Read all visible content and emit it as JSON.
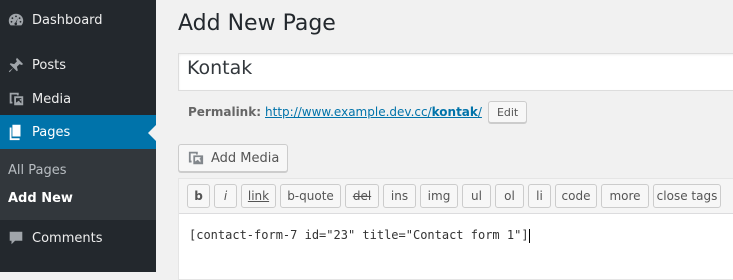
{
  "sidebar": {
    "items": [
      {
        "label": "Dashboard",
        "icon": "dashboard-icon"
      },
      {
        "label": "Posts",
        "icon": "pushpin-icon"
      },
      {
        "label": "Media",
        "icon": "media-icon"
      },
      {
        "label": "Pages",
        "icon": "pages-icon",
        "active": true
      },
      {
        "label": "Comments",
        "icon": "comment-icon"
      }
    ],
    "submenu": [
      {
        "label": "All Pages"
      },
      {
        "label": "Add New",
        "current": true
      }
    ]
  },
  "main": {
    "page_title": "Add New Page",
    "title_value": "Kontak",
    "permalink": {
      "label": "Permalink:",
      "base_url": "http://www.example.dev.cc/",
      "slug": "kontak",
      "trailing": "/",
      "edit_label": "Edit"
    },
    "add_media_label": "Add Media",
    "toolbar": [
      "b",
      "i",
      "link",
      "b-quote",
      "del",
      "ins",
      "img",
      "ul",
      "ol",
      "li",
      "code",
      "more",
      "close tags"
    ],
    "content": "[contact-form-7 id=\"23\" title=\"Contact form 1\"]"
  },
  "colors": {
    "sidebar_bg": "#23282d",
    "submenu_bg": "#32373c",
    "active_bg": "#0073aa",
    "link": "#0073aa"
  }
}
